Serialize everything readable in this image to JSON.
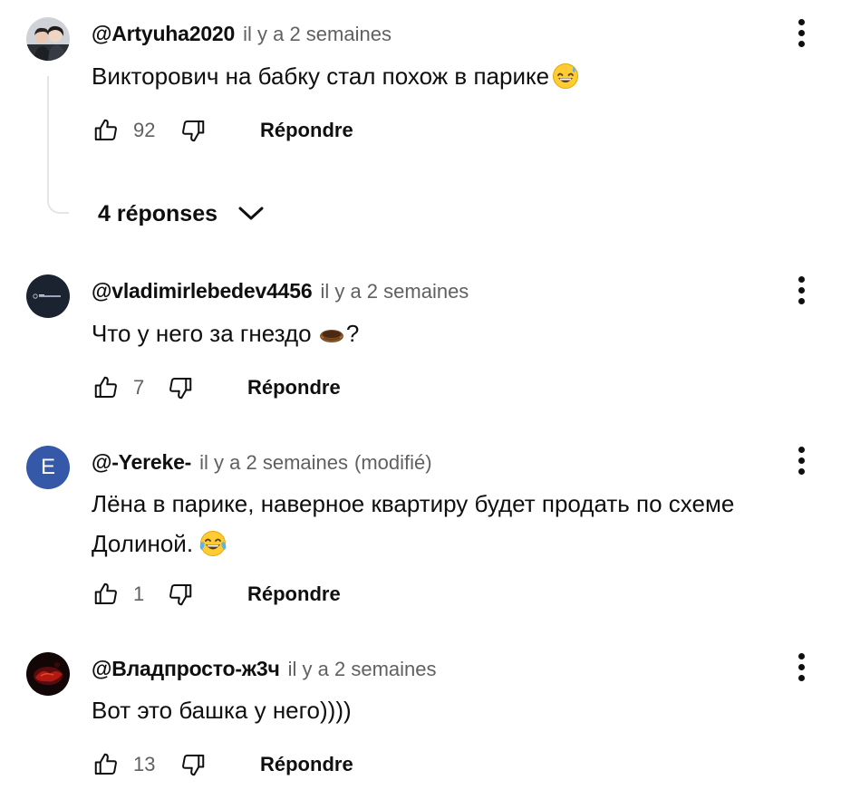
{
  "comments": [
    {
      "author": "@Artyuha2020",
      "time": "il y a 2 semaines",
      "edited": "",
      "text": "Викторович на бабку стал похож в парике",
      "emoji": "grinning-sweat-emoji",
      "likes": "92",
      "reply_label": "Répondre",
      "avatar": "photo-avatar"
    },
    {
      "author": "@vladimirlebedev4456",
      "time": "il y a 2 semaines",
      "edited": "",
      "text_before": "Что у него за гнездо ",
      "text_after": "?",
      "emoji": "nest-emoji",
      "likes": "7",
      "reply_label": "Répondre",
      "avatar": "dark-logo-avatar"
    },
    {
      "author": "@-Yereke-",
      "time": "il y a 2 semaines",
      "edited": "(modifié)",
      "text": "Лёна в парике, наверное квартиру будет продать по схеме Долиной.",
      "emoji": "tears-of-joy-emoji",
      "likes": "1",
      "reply_label": "Répondre",
      "avatar_letter": "E",
      "avatar_color": "#3559a8"
    },
    {
      "author": "@Владпросто-ж3ч",
      "time": "il y a 2 semaines",
      "edited": "",
      "text": "Вот это башка у него))))",
      "likes": "13",
      "reply_label": "Répondre",
      "avatar": "red-dark-avatar"
    }
  ],
  "replies_toggle": {
    "label": "4 réponses",
    "icon": "chevron-down-icon"
  },
  "colors": {
    "text_primary": "#0f0f0f",
    "text_secondary": "#606060",
    "thread_line": "#e5e5e5"
  }
}
